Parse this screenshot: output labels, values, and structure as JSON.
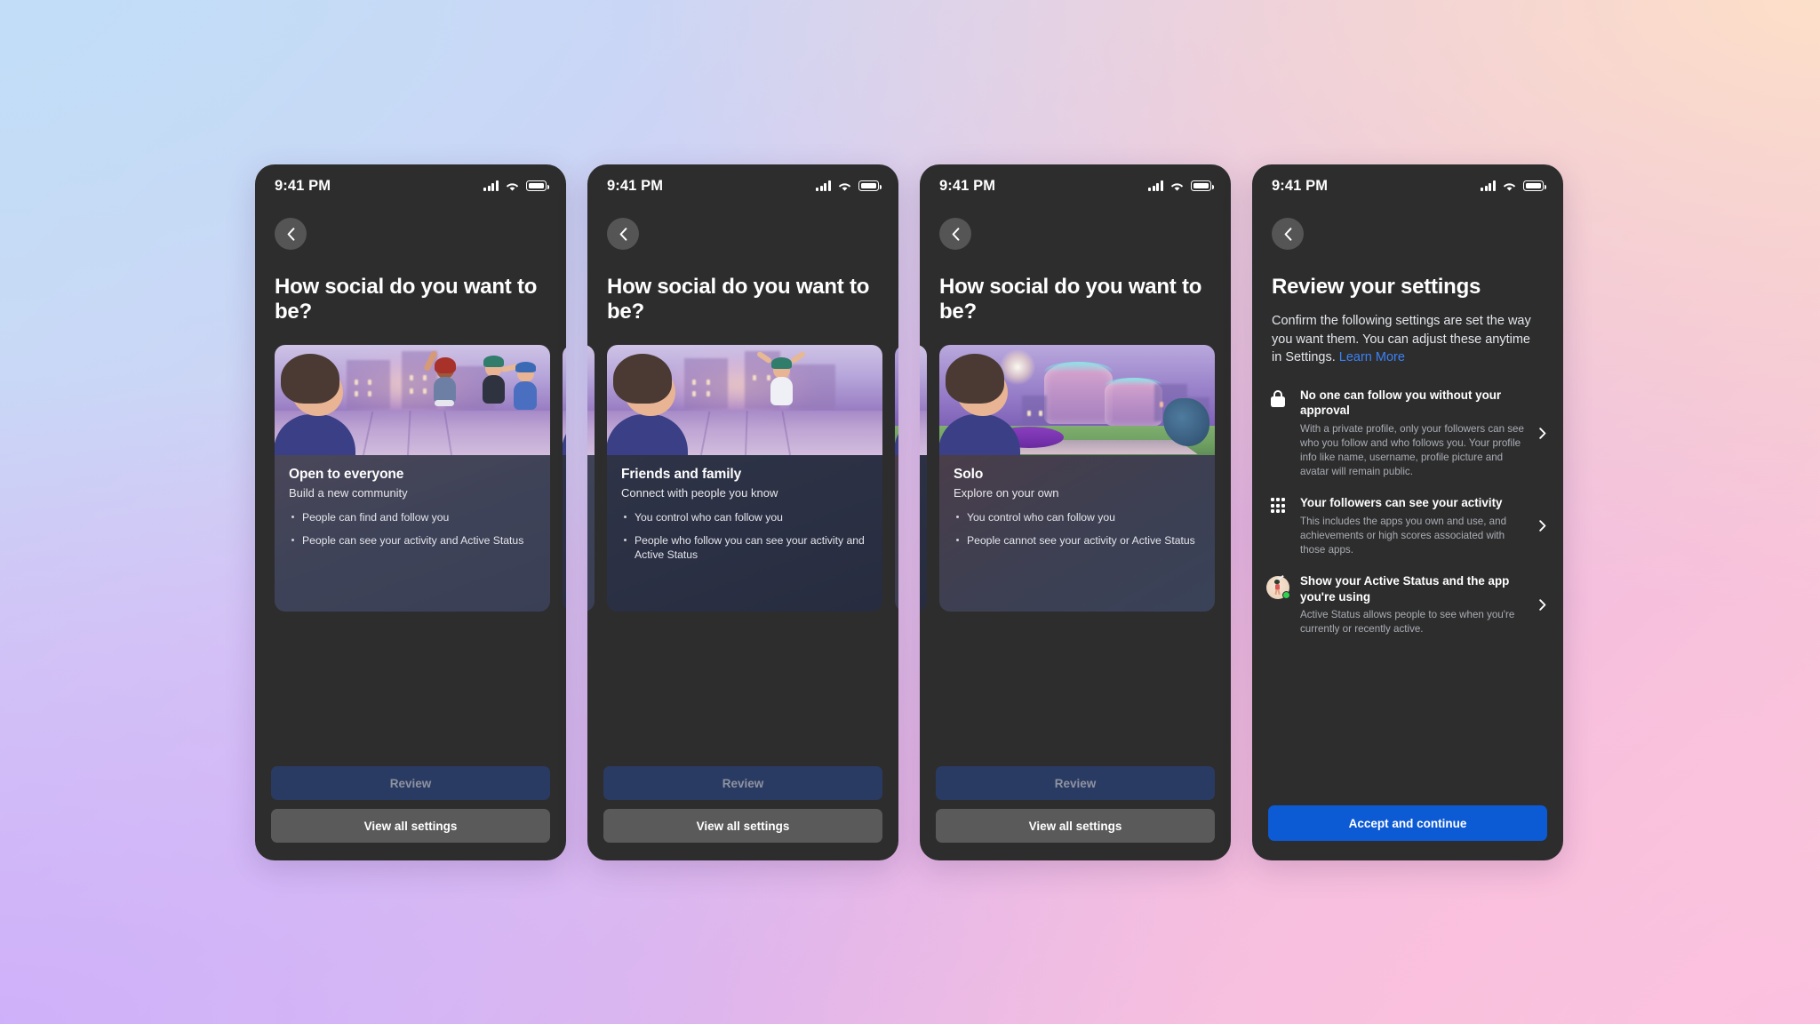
{
  "background": {
    "gradient_colors": [
      "#c2ddf7",
      "#fde0c8",
      "#ceaffa",
      "#fbbfe0"
    ]
  },
  "accent_colors": {
    "link": "#3b82f6",
    "primary_button": "#0c5ad4",
    "disabled_button": "#2a3b63",
    "secondary_button": "#5a5a5a",
    "online_dot": "#31d04f",
    "screen_bg": "#2d2d2d"
  },
  "status_bar": {
    "time": "9:41 PM",
    "icons": [
      "signal-bars-icon",
      "wifi-icon",
      "battery-icon"
    ]
  },
  "back_button": {
    "icon": "chevron-left-icon",
    "label": "Back"
  },
  "screens": [
    {
      "id": "open-to-everyone",
      "headline": "How social do you want to be?",
      "active_card_index": 0,
      "buttons": {
        "primary": {
          "label": "Review",
          "disabled": true
        },
        "secondary": {
          "label": "View all settings",
          "disabled": false
        }
      }
    },
    {
      "id": "friends-and-family",
      "headline": "How social do you want to be?",
      "active_card_index": 1,
      "buttons": {
        "primary": {
          "label": "Review",
          "disabled": true
        },
        "secondary": {
          "label": "View all settings",
          "disabled": false
        }
      }
    },
    {
      "id": "solo",
      "headline": "How social do you want to be?",
      "active_card_index": 2,
      "buttons": {
        "primary": {
          "label": "Review",
          "disabled": true
        },
        "secondary": {
          "label": "View all settings",
          "disabled": false
        }
      }
    }
  ],
  "cards": [
    {
      "title": "Open to everyone",
      "subtitle": "Build a new community",
      "bullets": [
        "People can find and follow you",
        "People can see your activity and Active Status"
      ],
      "image_alt": "avatar-group-city-scene"
    },
    {
      "title": "Friends and family",
      "subtitle": "Connect with people you know",
      "bullets": [
        "You control who can follow you",
        "People who follow you can see your activity and Active Status"
      ],
      "image_alt": "avatar-friends-city-scene"
    },
    {
      "title": "Solo",
      "subtitle": "Explore on your own",
      "bullets": [
        "You control who can follow you",
        "People cannot see your activity or Active Status"
      ],
      "image_alt": "avatar-solo-vr-city-scene"
    }
  ],
  "review_screen": {
    "headline": "Review your settings",
    "description_before_link": "Confirm the following settings are set the way you want them. You can adjust these anytime in Settings. ",
    "link_label": "Learn More",
    "items": [
      {
        "icon": "lock-icon",
        "title": "No one can follow you without your approval",
        "description": "With a private profile, only your followers can see who you follow and who follows you. Your profile info like name, username, profile picture and avatar will remain public.",
        "chevron": "chevron-right-icon"
      },
      {
        "icon": "app-grid-icon",
        "title": "Your followers can see your activity",
        "description": "This includes the apps you own and use, and achievements or high scores associated with those apps.",
        "chevron": "chevron-right-icon"
      },
      {
        "icon": "avatar-status-icon",
        "title": "Show your Active Status and the app you're using",
        "description": "Active Status allows people to see when you're currently or recently active.",
        "chevron": "chevron-right-icon"
      }
    ],
    "primary_button": {
      "label": "Accept and continue",
      "disabled": false
    }
  }
}
